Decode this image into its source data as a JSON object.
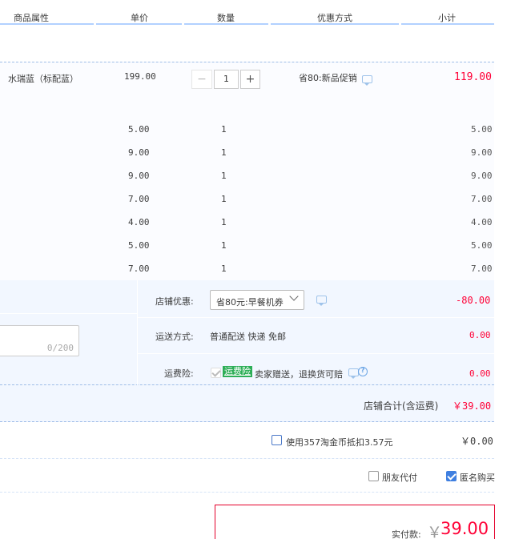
{
  "header": {
    "col_attr": "商品属性",
    "col_price": "单价",
    "col_qty": "数量",
    "col_discount": "优惠方式",
    "col_subtotal": "小计"
  },
  "main_item": {
    "attr": "水瑞蓝（标配蓝）",
    "price": "199.00",
    "qty": "1",
    "minus": "−",
    "plus": "+",
    "discount": "省80:新品促销",
    "subtotal": "119.00"
  },
  "sub_items": [
    {
      "price": "5.00",
      "qty": "1",
      "subtotal": "5.00"
    },
    {
      "price": "9.00",
      "qty": "1",
      "subtotal": "9.00"
    },
    {
      "price": "9.00",
      "qty": "1",
      "subtotal": "9.00"
    },
    {
      "price": "7.00",
      "qty": "1",
      "subtotal": "7.00"
    },
    {
      "price": "4.00",
      "qty": "1",
      "subtotal": "4.00"
    },
    {
      "price": "5.00",
      "qty": "1",
      "subtotal": "5.00"
    },
    {
      "price": "7.00",
      "qty": "1",
      "subtotal": "7.00"
    }
  ],
  "shop": {
    "discount_label": "店铺优惠:",
    "discount_select": "省80元:早餐机券",
    "discount_value": "-80.00",
    "shipping_label": "运送方式:",
    "shipping_value": "普通配送 快递 免邮",
    "shipping_amount": "0.00",
    "insurance_label": "运费险:",
    "insurance_badge": "运费险",
    "insurance_text": "卖家赠送，退换货可赔",
    "insurance_amount": "0.00",
    "message_counter": "0/200",
    "total_label": "店铺合计(含运费)",
    "total_value": "￥39.00"
  },
  "coins": {
    "label": "使用357淘金币抵扣3.57元",
    "value": "￥0.00"
  },
  "options": {
    "friend_pay": "朋友代付",
    "anonymous": "匿名购买"
  },
  "pay": {
    "label": "实付款:",
    "currency": "￥",
    "amount": "39.00"
  },
  "colors": {
    "accent_red": "#ff0036",
    "border_blue": "#b2d1ff",
    "area_bg": "#f2f7ff",
    "badge_green": "#2dae57"
  }
}
